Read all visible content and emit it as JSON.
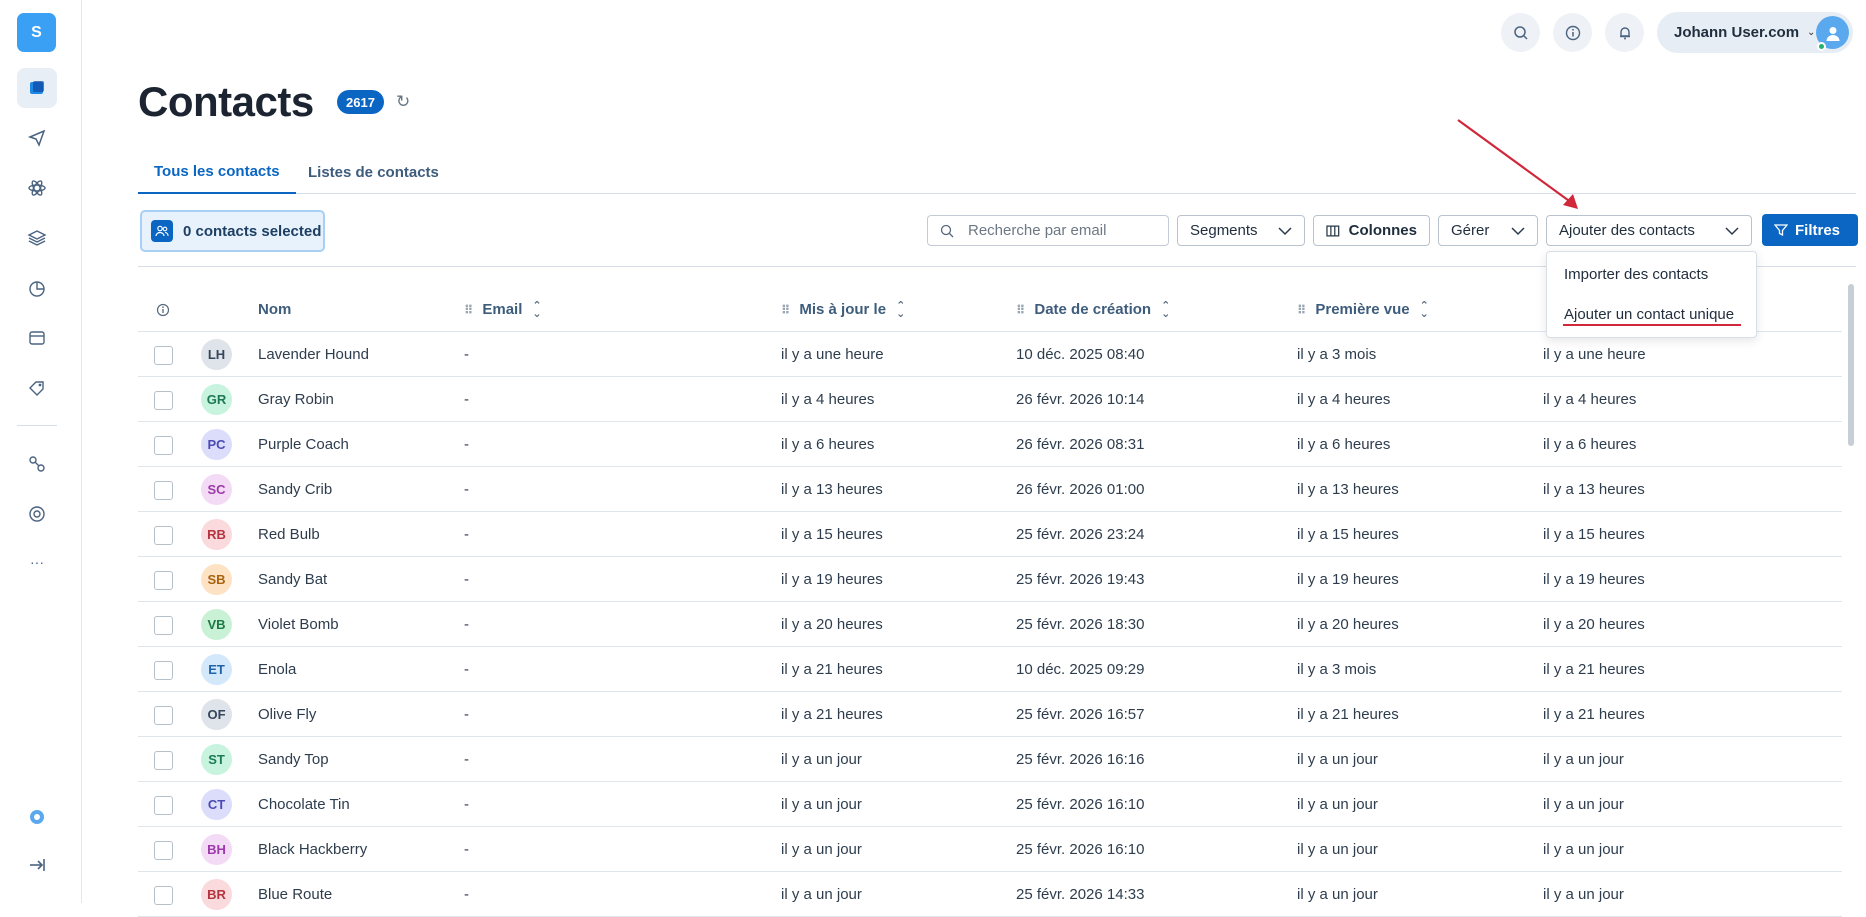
{
  "app": {
    "logo_letter": "S"
  },
  "topbar": {
    "user_name": "Johann User.com"
  },
  "page": {
    "title": "Contacts",
    "count": "2617"
  },
  "tabs": [
    {
      "label": "Tous les contacts",
      "active": true
    },
    {
      "label": "Listes de contacts",
      "active": false
    }
  ],
  "toolbar": {
    "selected_label": "0 contacts selected",
    "search_placeholder": "Recherche par email",
    "segments_label": "Segments",
    "columns_label": "Colonnes",
    "manage_label": "Gérer",
    "add_contacts_label": "Ajouter des contacts",
    "filters_label": "Filtres"
  },
  "dropdown": {
    "items": [
      "Importer des contacts",
      "Ajouter un contact unique"
    ]
  },
  "table": {
    "columns": [
      "Nom",
      "Email",
      "Mis à jour le",
      "Date de création",
      "Première vue"
    ],
    "rows": [
      {
        "initials": "LH",
        "name": "Lavender Hound",
        "email": "-",
        "updated": "il y a une heure",
        "created": "10 déc. 2025 08:40",
        "first_seen": "il y a 3 mois",
        "last": "il y a une heure",
        "color": "#dfe3ea",
        "text_color": "#34475c"
      },
      {
        "initials": "GR",
        "name": "Gray Robin",
        "email": "-",
        "updated": "il y a 4 heures",
        "created": "26 févr. 2026 10:14",
        "first_seen": "il y a 4 heures",
        "last": "il y a 4 heures",
        "color": "#c7f3df",
        "text_color": "#1d7a53"
      },
      {
        "initials": "PC",
        "name": "Purple Coach",
        "email": "-",
        "updated": "il y a 6 heures",
        "created": "26 févr. 2026 08:31",
        "first_seen": "il y a 6 heures",
        "last": "il y a 6 heures",
        "color": "#dcdcfb",
        "text_color": "#4b4bb3"
      },
      {
        "initials": "SC",
        "name": "Sandy Crib",
        "email": "-",
        "updated": "il y a 13 heures",
        "created": "26 févr. 2026 01:00",
        "first_seen": "il y a 13 heures",
        "last": "il y a 13 heures",
        "color": "#f3dbf6",
        "text_color": "#9b3aa8"
      },
      {
        "initials": "RB",
        "name": "Red Bulb",
        "email": "-",
        "updated": "il y a 15 heures",
        "created": "25 févr. 2026 23:24",
        "first_seen": "il y a 15 heures",
        "last": "il y a 15 heures",
        "color": "#fadadd",
        "text_color": "#b3343f"
      },
      {
        "initials": "SB",
        "name": "Sandy Bat",
        "email": "-",
        "updated": "il y a 19 heures",
        "created": "25 févr. 2026 19:43",
        "first_seen": "il y a 19 heures",
        "last": "il y a 19 heures",
        "color": "#fde3c4",
        "text_color": "#a9630f"
      },
      {
        "initials": "VB",
        "name": "Violet Bomb",
        "email": "-",
        "updated": "il y a 20 heures",
        "created": "25 févr. 2026 18:30",
        "first_seen": "il y a 20 heures",
        "last": "il y a 20 heures",
        "color": "#c9f1d6",
        "text_color": "#1e7a44"
      },
      {
        "initials": "ET",
        "name": "Enola",
        "email": "-",
        "updated": "il y a 21 heures",
        "created": "10 déc. 2025 09:29",
        "first_seen": "il y a 3 mois",
        "last": "il y a 21 heures",
        "color": "#d3e8fb",
        "text_color": "#1f63a8"
      },
      {
        "initials": "OF",
        "name": "Olive Fly",
        "email": "-",
        "updated": "il y a 21 heures",
        "created": "25 févr. 2026 16:57",
        "first_seen": "il y a 21 heures",
        "last": "il y a 21 heures",
        "color": "#dfe3ea",
        "text_color": "#34475c"
      },
      {
        "initials": "ST",
        "name": "Sandy Top",
        "email": "-",
        "updated": "il y a un jour",
        "created": "25 févr. 2026 16:16",
        "first_seen": "il y a un jour",
        "last": "il y a un jour",
        "color": "#c7f3df",
        "text_color": "#1d7a53"
      },
      {
        "initials": "CT",
        "name": "Chocolate Tin",
        "email": "-",
        "updated": "il y a un jour",
        "created": "25 févr. 2026 16:10",
        "first_seen": "il y a un jour",
        "last": "il y a un jour",
        "color": "#dcdcfb",
        "text_color": "#4b4bb3"
      },
      {
        "initials": "BH",
        "name": "Black Hackberry",
        "email": "-",
        "updated": "il y a un jour",
        "created": "25 févr. 2026 16:10",
        "first_seen": "il y a un jour",
        "last": "il y a un jour",
        "color": "#f3dbf6",
        "text_color": "#9b3aa8"
      },
      {
        "initials": "BR",
        "name": "Blue Route",
        "email": "-",
        "updated": "il y a un jour",
        "created": "25 févr. 2026 14:33",
        "first_seen": "il y a un jour",
        "last": "il y a un jour",
        "color": "#fadadd",
        "text_color": "#b3343f"
      }
    ]
  },
  "colors": {
    "primary": "#0b66c3",
    "annotation_red": "#d0283a"
  }
}
